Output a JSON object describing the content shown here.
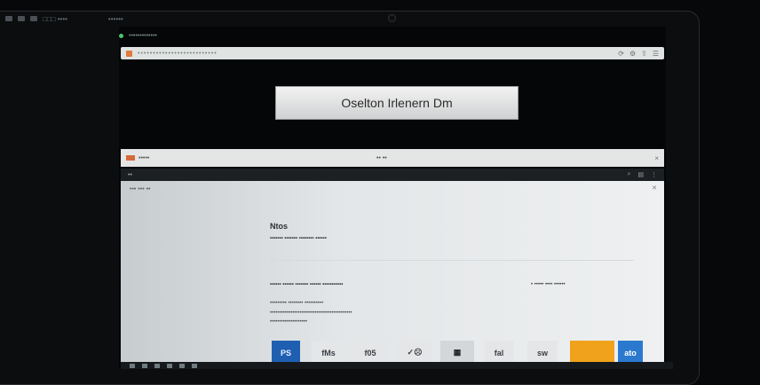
{
  "top_strip": {
    "text_1": "□□□ ••••",
    "text_2": "••••••"
  },
  "screen": {
    "status_text": "•••••••••••••",
    "browser_url": "••••••••••••••••••••••••••",
    "hero_text": "Oselton Irlenern Dm",
    "tab_title": "•••••",
    "tab_center": "•• ••",
    "app_bar_left": "••",
    "breadcrumb": "••• ••• ••",
    "page_heading": "Ntos",
    "line1": "••••••• ••••••• •••••••• ••••••",
    "line2": "•••••• •••••• ••••••• •••••• •••••••••••",
    "line2_right": "• ••••• •••• ••••••",
    "p1": "••••••••• •••••••• ••••••••••",
    "p2": "••••••••••••••••••••••••••••••••••••••••••••",
    "p3": "••••••••••••••••••••"
  },
  "cards": {
    "c1": "PS",
    "c2": "fMs",
    "c3": "f05",
    "c4": "✓☹",
    "c5": "▦",
    "c6": "fal",
    "c7": "sw",
    "c8": "",
    "c9": "ato"
  }
}
